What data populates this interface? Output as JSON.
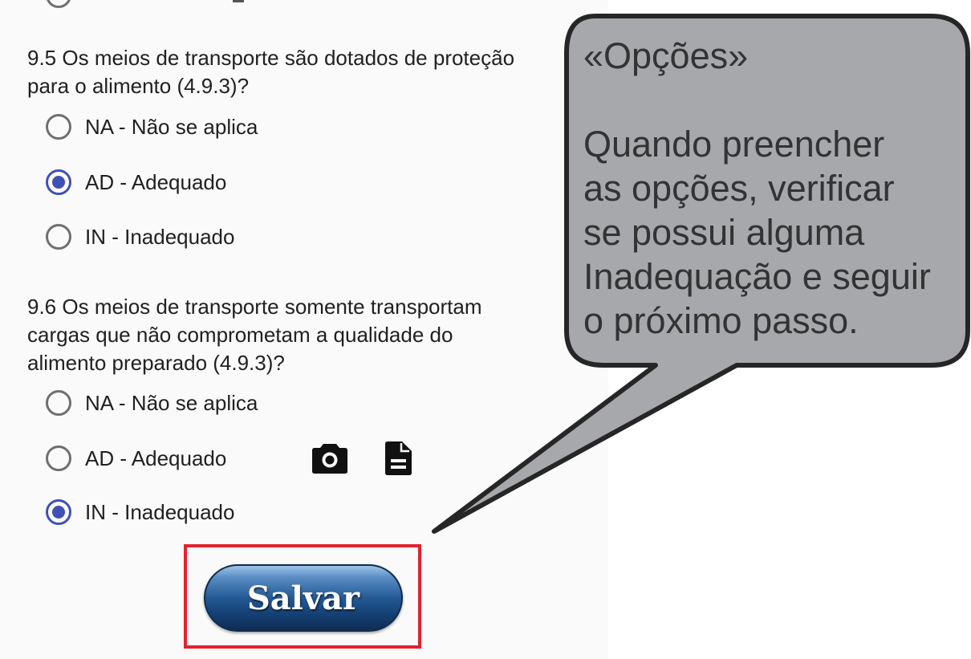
{
  "questions": [
    {
      "text_lines": [
        "9.5 Os meios de transporte são dotados de proteção",
        "para o alimento (4.9.3)?"
      ],
      "options": [
        {
          "label": "NA - Não se aplica",
          "selected": false
        },
        {
          "label": "AD - Adequado",
          "selected": true
        },
        {
          "label": "IN - Inadequado",
          "selected": false
        }
      ]
    },
    {
      "text_lines": [
        "9.6 Os meios de transporte somente transportam",
        "cargas que não comprometam a qualidade do",
        "alimento preparado (4.9.3)?"
      ],
      "options": [
        {
          "label": "NA - Não se aplica",
          "selected": false
        },
        {
          "label": "AD - Adequado",
          "selected": false
        },
        {
          "label": "IN - Inadequado",
          "selected": true
        }
      ]
    }
  ],
  "icons": {
    "camera": "camera-icon",
    "document": "document-icon"
  },
  "save_label": "Salvar",
  "callout": {
    "title": "«Opções»",
    "lines": [
      "Quando preencher",
      "as opções, verificar",
      "se possui alguma",
      "Inadequação e seguir",
      "o próximo passo."
    ]
  },
  "colors": {
    "radio_selected": "#3f51b5",
    "radio_unselected": "#6f6f6f",
    "highlight_frame": "#e3222d",
    "callout_fill": "#a7a8ac",
    "save_button": "#245994"
  }
}
